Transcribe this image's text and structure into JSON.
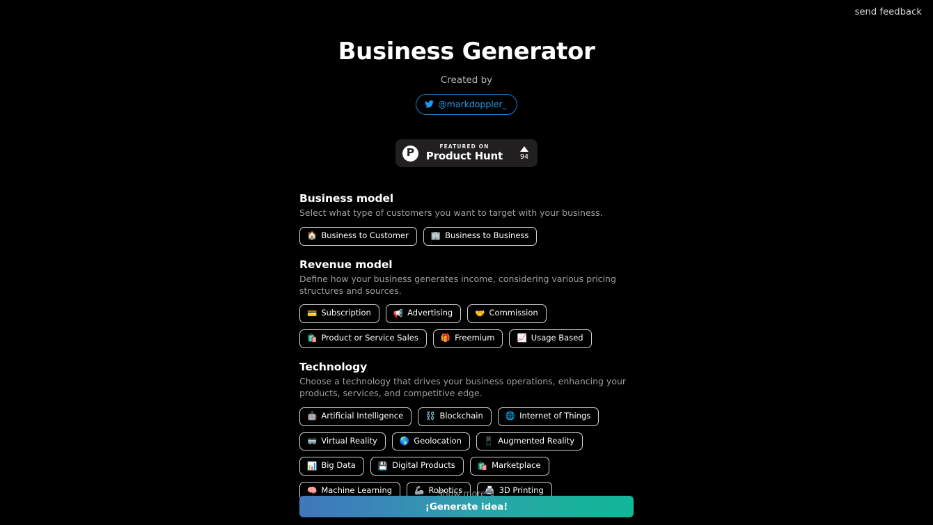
{
  "topbar": {
    "feedback_label": "send feedback"
  },
  "header": {
    "title": "Business Generator",
    "created_by_label": "Created by",
    "twitter_handle": "@markdoppler_",
    "twitter_icon": "twitter-bird-icon"
  },
  "product_hunt": {
    "logo_letter": "P",
    "featured_label": "FEATURED ON",
    "name": "Product Hunt",
    "upvote_icon": "triangle-up-icon",
    "upvote_count": "94"
  },
  "sections": [
    {
      "id": "business-model",
      "title": "Business model",
      "description": "Select what type of customers you want to target with your business.",
      "options": [
        {
          "emoji": "🏠",
          "icon_name": "house-icon",
          "label": "Business to Customer"
        },
        {
          "emoji": "🏢",
          "icon_name": "office-building-icon",
          "label": "Business to Business"
        }
      ]
    },
    {
      "id": "revenue-model",
      "title": "Revenue model",
      "description": "Define how your business generates income, considering various pricing structures and sources.",
      "options": [
        {
          "emoji": "💳",
          "icon_name": "credit-card-icon",
          "label": "Subscription"
        },
        {
          "emoji": "📢",
          "icon_name": "megaphone-icon",
          "label": "Advertising"
        },
        {
          "emoji": "🤝",
          "icon_name": "handshake-icon",
          "label": "Commission"
        },
        {
          "emoji": "🛍️",
          "icon_name": "shopping-bags-icon",
          "label": "Product or Service Sales"
        },
        {
          "emoji": "🎁",
          "icon_name": "gift-icon",
          "label": "Freemium"
        },
        {
          "emoji": "📈",
          "icon_name": "chart-increasing-icon",
          "label": "Usage Based"
        }
      ]
    },
    {
      "id": "technology",
      "title": "Technology",
      "description": "Choose a technology that drives your business operations, enhancing your products, services, and competitive edge.",
      "options": [
        {
          "emoji": "🤖",
          "icon_name": "robot-icon",
          "label": "Artificial Intelligence"
        },
        {
          "emoji": "⛓️",
          "icon_name": "chains-icon",
          "label": "Blockchain"
        },
        {
          "emoji": "🌐",
          "icon_name": "globe-meridians-icon",
          "label": "Internet of Things"
        },
        {
          "emoji": "🥽",
          "icon_name": "goggles-icon",
          "label": "Virtual Reality"
        },
        {
          "emoji": "🌎",
          "icon_name": "globe-americas-icon",
          "label": "Geolocation"
        },
        {
          "emoji": "📱",
          "icon_name": "mobile-phone-icon",
          "label": "Augmented Reality"
        },
        {
          "emoji": "📊",
          "icon_name": "bar-chart-icon",
          "label": "Big Data"
        },
        {
          "emoji": "💾",
          "icon_name": "floppy-disk-icon",
          "label": "Digital Products"
        },
        {
          "emoji": "🛍️",
          "icon_name": "shopping-bags-icon",
          "label": "Marketplace"
        },
        {
          "emoji": "🧠",
          "icon_name": "brain-icon",
          "label": "Machine Learning"
        },
        {
          "emoji": "🦾",
          "icon_name": "mechanical-arm-icon",
          "label": "Robotics"
        },
        {
          "emoji": "🖨️",
          "icon_name": "printer-icon",
          "label": "3D Printing"
        }
      ]
    }
  ],
  "footer": {
    "show_more_label": "Show more ⌄",
    "generate_label": "¡Generate idea!"
  },
  "colors": {
    "background": "#000000",
    "chip_border": "#cfcfcf",
    "twitter_blue": "#1d9bf0",
    "gradient_start": "#3f77bb",
    "gradient_end": "#12b79a",
    "muted_text": "#9e9e9e"
  }
}
